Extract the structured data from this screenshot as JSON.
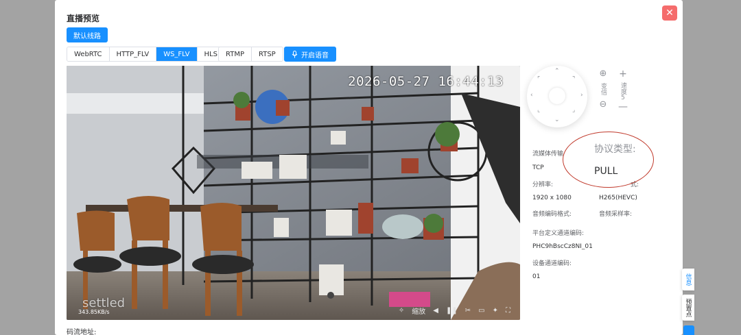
{
  "dialog": {
    "title": "直播预览",
    "close_icon": "close-icon",
    "route_label": "默认线路"
  },
  "protocol_tabs": {
    "group1": [
      "WebRTC",
      "HTTP_FLV",
      "WS_FLV",
      "HLS"
    ],
    "group2": [
      "RTMP",
      "RTSP"
    ],
    "active": "WS_FLV",
    "voice_label": "开启语音",
    "voice_icon": "microphone-icon"
  },
  "player": {
    "osd_time": "2026-05-27 16:44:13",
    "watermark": "settled",
    "bitrate": "343.85KB/s",
    "zoom_label": "缩放",
    "controls": [
      "screenshot-icon",
      "zoom-label",
      "volume-icon",
      "pause-icon",
      "cut-icon",
      "record-icon",
      "pin-icon",
      "fullscreen-icon"
    ]
  },
  "ptz": {
    "zoom_label": "变倍",
    "speed_label": "速度",
    "speed_value": "5"
  },
  "stream_info": {
    "transport_label": "流媒体传输",
    "transport_value": "TCP",
    "protocol_label": "协议类型:",
    "protocol_value": "PULL",
    "resolution_label": "分辨率:",
    "resolution_value": "1920 x 1080",
    "codec_label": "式:",
    "codec_value": "H265(HEVC)",
    "audio_codec_label": "音频编码格式:",
    "audio_rate_label": "音频采样率:",
    "platform_channel_label": "平台定义通道编码:",
    "platform_channel_value": "PHC9hBscCz8NI_01",
    "device_channel_label": "设备通道编码:",
    "device_channel_value": "01"
  },
  "footer": {
    "stream_addr_label": "码流地址:"
  },
  "side_tabs": [
    "信息",
    "预置点"
  ],
  "colors": {
    "primary": "#1890ff",
    "danger": "#f56c6c",
    "annotation": "#c0392b"
  }
}
